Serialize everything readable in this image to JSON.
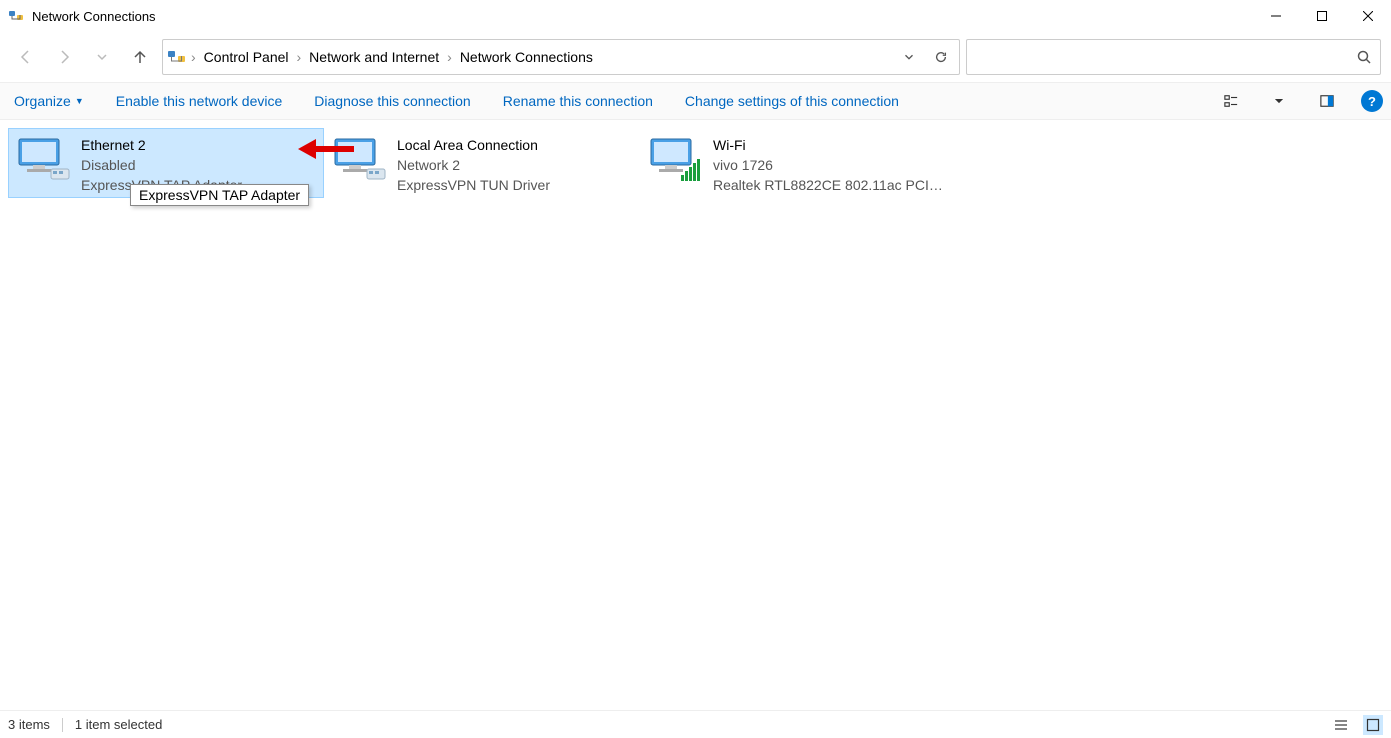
{
  "window": {
    "title": "Network Connections"
  },
  "breadcrumbs": {
    "items": [
      "Control Panel",
      "Network and Internet",
      "Network Connections"
    ]
  },
  "search": {
    "placeholder": ""
  },
  "commands": {
    "organize": "Organize",
    "enable": "Enable this network device",
    "diagnose": "Diagnose this connection",
    "rename": "Rename this connection",
    "change_settings": "Change settings of this connection"
  },
  "network_items": [
    {
      "name": "Ethernet 2",
      "status": "Disabled",
      "adapter": "ExpressVPN TAP Adapter",
      "selected": true,
      "icon": "monitor-disabled"
    },
    {
      "name": "Local Area Connection",
      "status": "Network 2",
      "adapter": "ExpressVPN TUN Driver",
      "selected": false,
      "icon": "monitor"
    },
    {
      "name": "Wi-Fi",
      "status": "vivo 1726",
      "adapter": "Realtek RTL8822CE 802.11ac PCIe ...",
      "selected": false,
      "icon": "monitor-wifi"
    }
  ],
  "tooltip": {
    "text": "ExpressVPN TAP Adapter"
  },
  "statusbar": {
    "count": "3 items",
    "selected": "1 item selected"
  }
}
